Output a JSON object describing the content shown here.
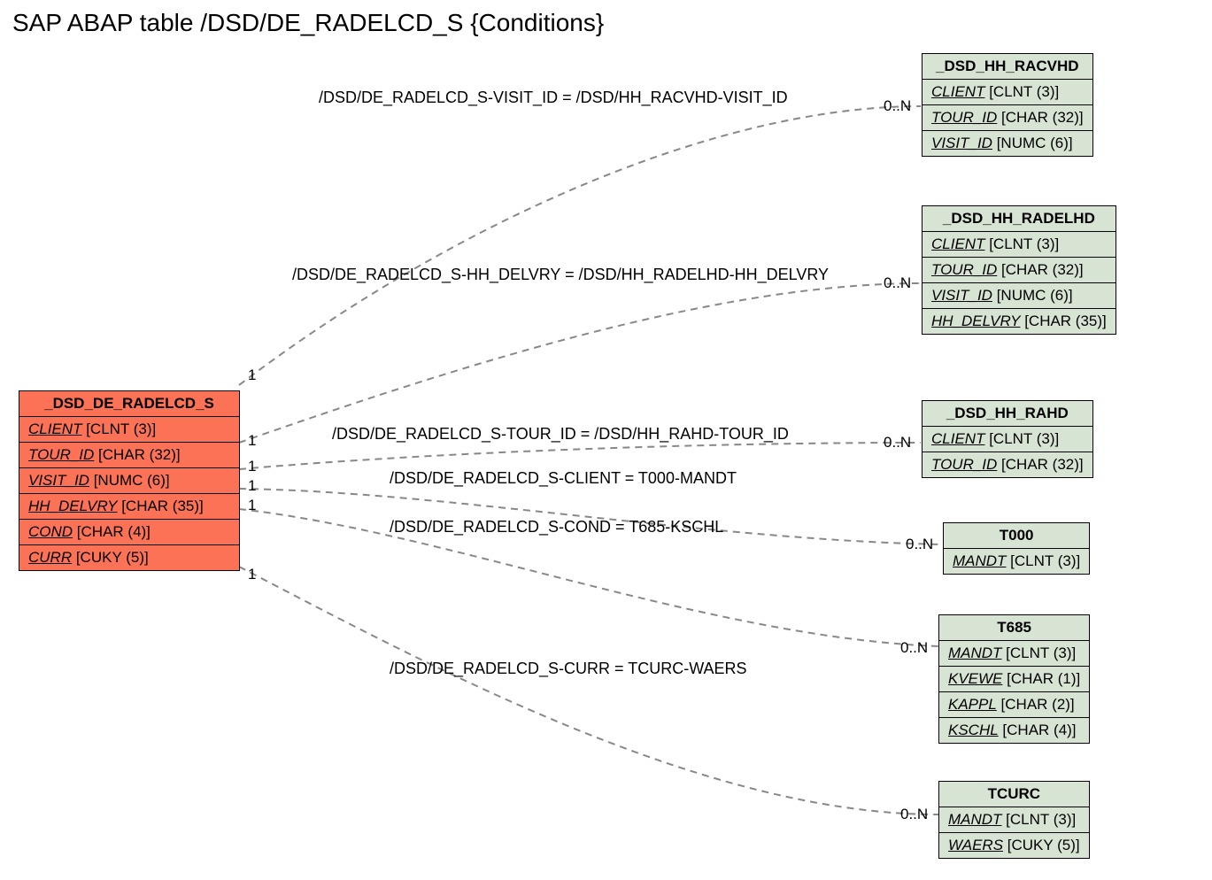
{
  "title": "SAP ABAP table /DSD/DE_RADELCD_S {Conditions}",
  "main": {
    "name": "_DSD_DE_RADELCD_S",
    "fields": [
      {
        "n": "CLIENT",
        "t": "[CLNT (3)]"
      },
      {
        "n": "TOUR_ID",
        "t": "[CHAR (32)]"
      },
      {
        "n": "VISIT_ID",
        "t": "[NUMC (6)]"
      },
      {
        "n": "HH_DELVRY",
        "t": "[CHAR (35)]"
      },
      {
        "n": "COND",
        "t": "[CHAR (4)]"
      },
      {
        "n": "CURR",
        "t": "[CUKY (5)]"
      }
    ]
  },
  "refs": [
    {
      "name": "_DSD_HH_RACVHD",
      "fields": [
        {
          "n": "CLIENT",
          "t": "[CLNT (3)]"
        },
        {
          "n": "TOUR_ID",
          "t": "[CHAR (32)]"
        },
        {
          "n": "VISIT_ID",
          "t": "[NUMC (6)]"
        }
      ]
    },
    {
      "name": "_DSD_HH_RADELHD",
      "fields": [
        {
          "n": "CLIENT",
          "t": "[CLNT (3)]"
        },
        {
          "n": "TOUR_ID",
          "t": "[CHAR (32)]"
        },
        {
          "n": "VISIT_ID",
          "t": "[NUMC (6)]"
        },
        {
          "n": "HH_DELVRY",
          "t": "[CHAR (35)]"
        }
      ]
    },
    {
      "name": "_DSD_HH_RAHD",
      "fields": [
        {
          "n": "CLIENT",
          "t": "[CLNT (3)]"
        },
        {
          "n": "TOUR_ID",
          "t": "[CHAR (32)]"
        }
      ]
    },
    {
      "name": "T000",
      "fields": [
        {
          "n": "MANDT",
          "t": "[CLNT (3)]"
        }
      ]
    },
    {
      "name": "T685",
      "fields": [
        {
          "n": "MANDT",
          "t": "[CLNT (3)]"
        },
        {
          "n": "KVEWE",
          "t": "[CHAR (1)]"
        },
        {
          "n": "KAPPL",
          "t": "[CHAR (2)]"
        },
        {
          "n": "KSCHL",
          "t": "[CHAR (4)]"
        }
      ]
    },
    {
      "name": "TCURC",
      "fields": [
        {
          "n": "MANDT",
          "t": "[CLNT (3)]"
        },
        {
          "n": "WAERS",
          "t": "[CUKY (5)]"
        }
      ]
    }
  ],
  "rels": [
    {
      "label": "/DSD/DE_RADELCD_S-VISIT_ID = /DSD/HH_RACVHD-VISIT_ID",
      "left": "1",
      "right": "0..N"
    },
    {
      "label": "/DSD/DE_RADELCD_S-HH_DELVRY = /DSD/HH_RADELHD-HH_DELVRY",
      "left": "1",
      "right": "0..N"
    },
    {
      "label": "/DSD/DE_RADELCD_S-TOUR_ID = /DSD/HH_RAHD-TOUR_ID",
      "left": "1",
      "right": "0..N"
    },
    {
      "label": "/DSD/DE_RADELCD_S-CLIENT = T000-MANDT",
      "left": "1",
      "right": "0..N"
    },
    {
      "label": "/DSD/DE_RADELCD_S-COND = T685-KSCHL",
      "left": "1",
      "right": "0..N"
    },
    {
      "label": "/DSD/DE_RADELCD_S-CURR = TCURC-WAERS",
      "left": "1",
      "right": "0..N"
    }
  ]
}
